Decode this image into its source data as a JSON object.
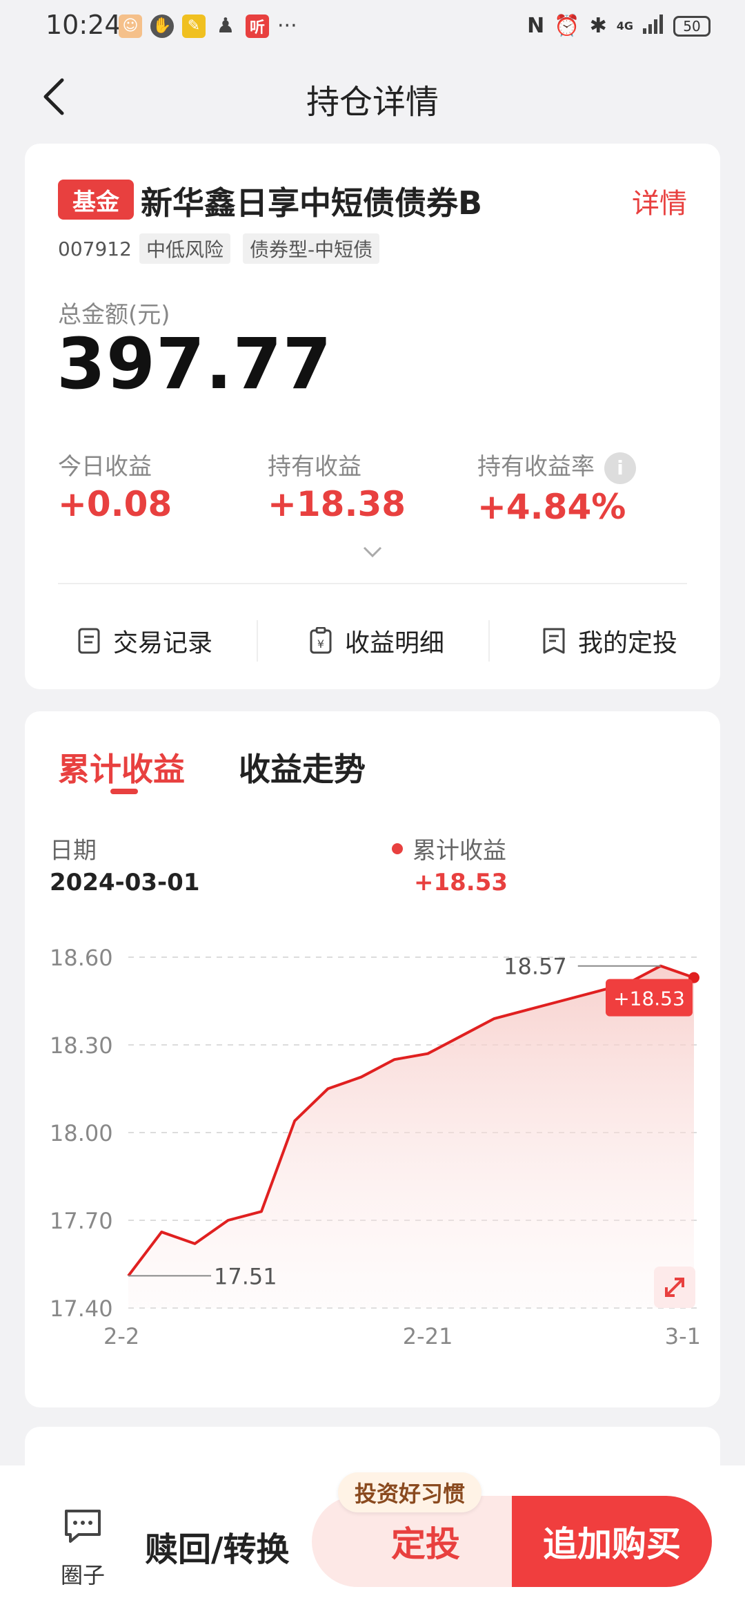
{
  "status_bar": {
    "time": "10:24",
    "ellipsis": "···",
    "network": "4G",
    "battery": "50",
    "left_icons": [
      "app-icon-1",
      "shield-icon",
      "app-icon-2",
      "qq-icon",
      "listen-icon"
    ],
    "listen_icon_text": "听"
  },
  "nav": {
    "title": "持仓详情"
  },
  "fund": {
    "badge": "基金",
    "name": "新华鑫日享中短债债券B",
    "detail_link": "详情",
    "code": "007912",
    "tags": [
      "中低风险",
      "债券型-中短债"
    ],
    "total_label": "总金额(元)",
    "total_value": "397.77",
    "stats": [
      {
        "label": "今日收益",
        "value": "+0.08"
      },
      {
        "label": "持有收益",
        "value": "+18.38"
      },
      {
        "label": "持有收益率",
        "value": "+4.84%"
      }
    ],
    "actions": [
      "交易记录",
      "收益明细",
      "我的定投"
    ]
  },
  "chart_tabs": {
    "active": "累计收益",
    "inactive": "收益走势"
  },
  "chart_header": {
    "date_label": "日期",
    "date_value": "2024-03-01",
    "series_label": "累计收益",
    "series_value": "+18.53"
  },
  "chart_data": {
    "type": "area",
    "x": [
      "2-2",
      "2-4",
      "2-6",
      "2-8",
      "2-10",
      "2-14",
      "2-16",
      "2-18",
      "2-20",
      "2-21",
      "2-22",
      "2-23",
      "2-24",
      "2-26",
      "2-27",
      "2-28",
      "2-29",
      "3-1"
    ],
    "values": [
      17.51,
      17.66,
      17.62,
      17.7,
      17.73,
      18.04,
      18.15,
      18.19,
      18.25,
      18.27,
      18.33,
      18.39,
      18.42,
      18.45,
      18.48,
      18.51,
      18.57,
      18.53
    ],
    "ylim": [
      17.4,
      18.6
    ],
    "yticks": [
      "18.60",
      "18.30",
      "18.00",
      "17.70",
      "17.40"
    ],
    "xticks": [
      "2-2",
      "2-21",
      "3-1"
    ],
    "max_label": "18.57",
    "min_label": "17.51",
    "current_label": "+18.53",
    "line_color": "#e02020",
    "grid": true
  },
  "bottom": {
    "circle_label": "圈子",
    "redeem": "赎回/转换",
    "sip": "定投",
    "sip_hint": "投资好习惯",
    "buy": "追加购买"
  }
}
